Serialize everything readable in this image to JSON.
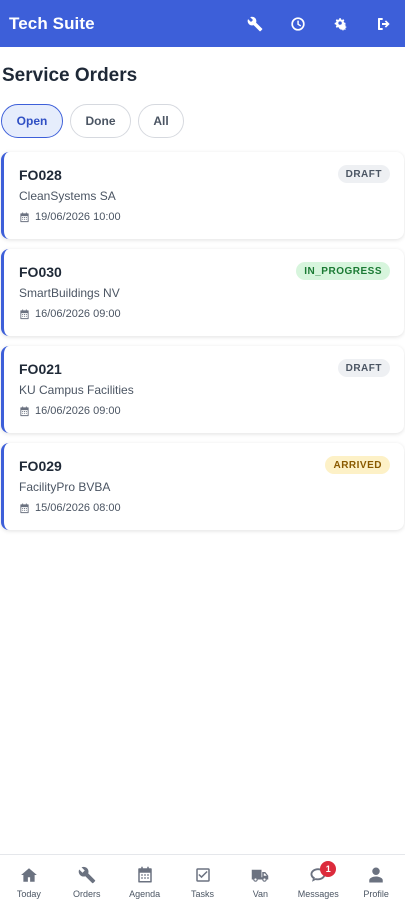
{
  "app": {
    "title": "Tech Suite"
  },
  "header_icons": [
    {
      "name": "wrench-icon"
    },
    {
      "name": "clock-icon"
    },
    {
      "name": "gears-icon"
    },
    {
      "name": "logout-icon"
    }
  ],
  "page": {
    "title": "Service Orders"
  },
  "filters": [
    {
      "label": "Open",
      "active": true
    },
    {
      "label": "Done",
      "active": false
    },
    {
      "label": "All",
      "active": false
    }
  ],
  "orders": [
    {
      "code": "FO028",
      "client": "CleanSystems SA",
      "date": "19/06/2026 10:00",
      "status": "DRAFT",
      "status_bg": "#eef0f3",
      "status_color": "#4b5563"
    },
    {
      "code": "FO030",
      "client": "SmartBuildings NV",
      "date": "16/06/2026 09:00",
      "status": "IN_PROGRESS",
      "status_bg": "#d7f5dd",
      "status_color": "#1b7a34"
    },
    {
      "code": "FO021",
      "client": "KU Campus Facilities",
      "date": "16/06/2026 09:00",
      "status": "DRAFT",
      "status_bg": "#eef0f3",
      "status_color": "#4b5563"
    },
    {
      "code": "FO029",
      "client": "FacilityPro BVBA",
      "date": "15/06/2026 08:00",
      "status": "ARRIVED",
      "status_bg": "#fdf1c7",
      "status_color": "#8a5a00"
    }
  ],
  "bottom_nav": [
    {
      "label": "Today",
      "icon": "home-icon"
    },
    {
      "label": "Orders",
      "icon": "wrench-icon"
    },
    {
      "label": "Agenda",
      "icon": "calendar-icon"
    },
    {
      "label": "Tasks",
      "icon": "check-square-icon"
    },
    {
      "label": "Van",
      "icon": "truck-icon"
    },
    {
      "label": "Messages",
      "icon": "chat-icon",
      "badge": "1"
    },
    {
      "label": "Profile",
      "icon": "user-icon"
    }
  ],
  "colors": {
    "primary": "#3d5fd9",
    "badge_red": "#dc2b3c"
  }
}
